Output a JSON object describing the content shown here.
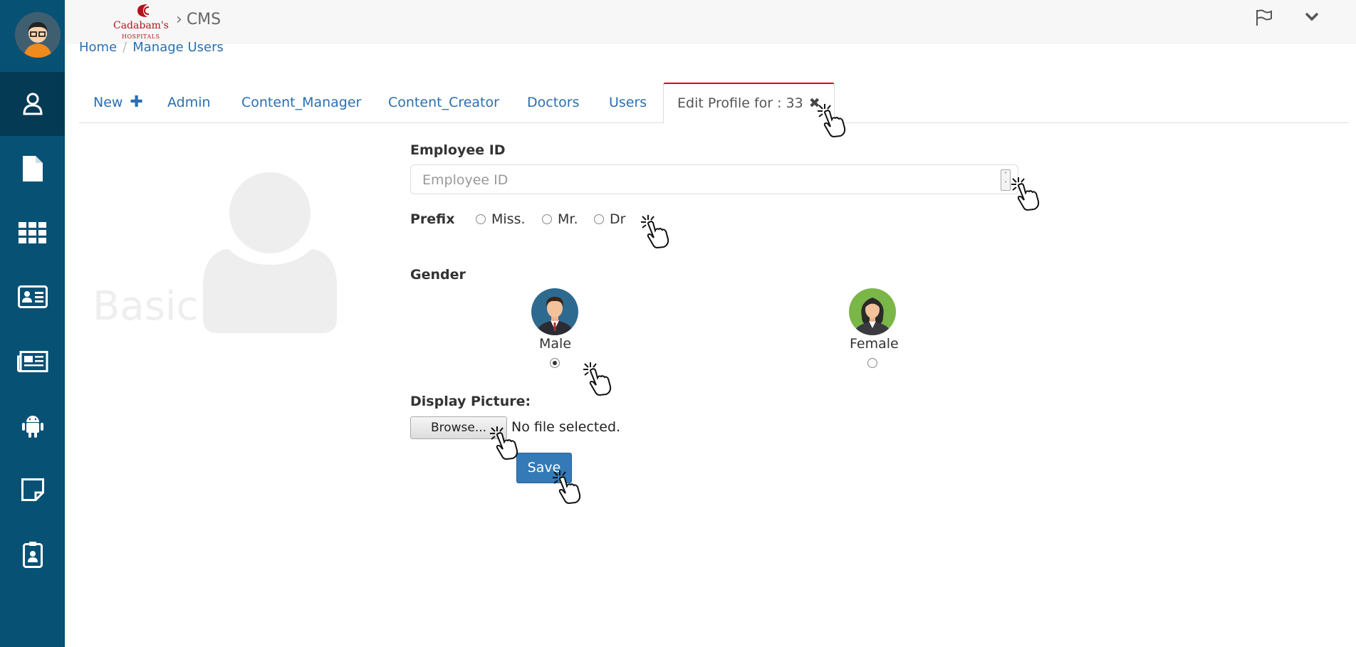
{
  "header": {
    "app_name": "CMS",
    "logo_text": "Cadabam's",
    "logo_subtext": "HOSPITALS"
  },
  "breadcrumb": {
    "home": "Home",
    "separator": "/",
    "current": "Manage Users"
  },
  "tabs": [
    {
      "label": "New",
      "icon": "plus-icon"
    },
    {
      "label": "Admin"
    },
    {
      "label": "Content_Manager"
    },
    {
      "label": "Content_Creator"
    },
    {
      "label": "Doctors"
    },
    {
      "label": "Users"
    },
    {
      "label": "Edit Profile for : 33",
      "icon": "close-icon",
      "active": true
    }
  ],
  "side_title": "Basic",
  "form": {
    "employee_id_label": "Employee ID",
    "employee_id_placeholder": "Employee ID",
    "prefix_label": "Prefix",
    "prefix_options": [
      "Miss.",
      "Mr.",
      "Dr"
    ],
    "gender_label": "Gender",
    "gender_options": [
      {
        "label": "Male",
        "selected": true
      },
      {
        "label": "Female",
        "selected": false
      }
    ],
    "display_picture_label": "Display Picture:",
    "browse_label": "Browse...",
    "file_status": "No file selected.",
    "save_label": "Save"
  },
  "sidebar_icons": [
    "user-icon",
    "file-icon",
    "grid-icon",
    "id-card-icon",
    "newspaper-icon",
    "android-icon",
    "note-icon",
    "badge-icon"
  ],
  "colors": {
    "sidebar": "#075175",
    "sidebar_active": "#053a55",
    "link": "#2a6fb0",
    "primary_button": "#337ab7",
    "active_tab_border": "#ee0000"
  }
}
